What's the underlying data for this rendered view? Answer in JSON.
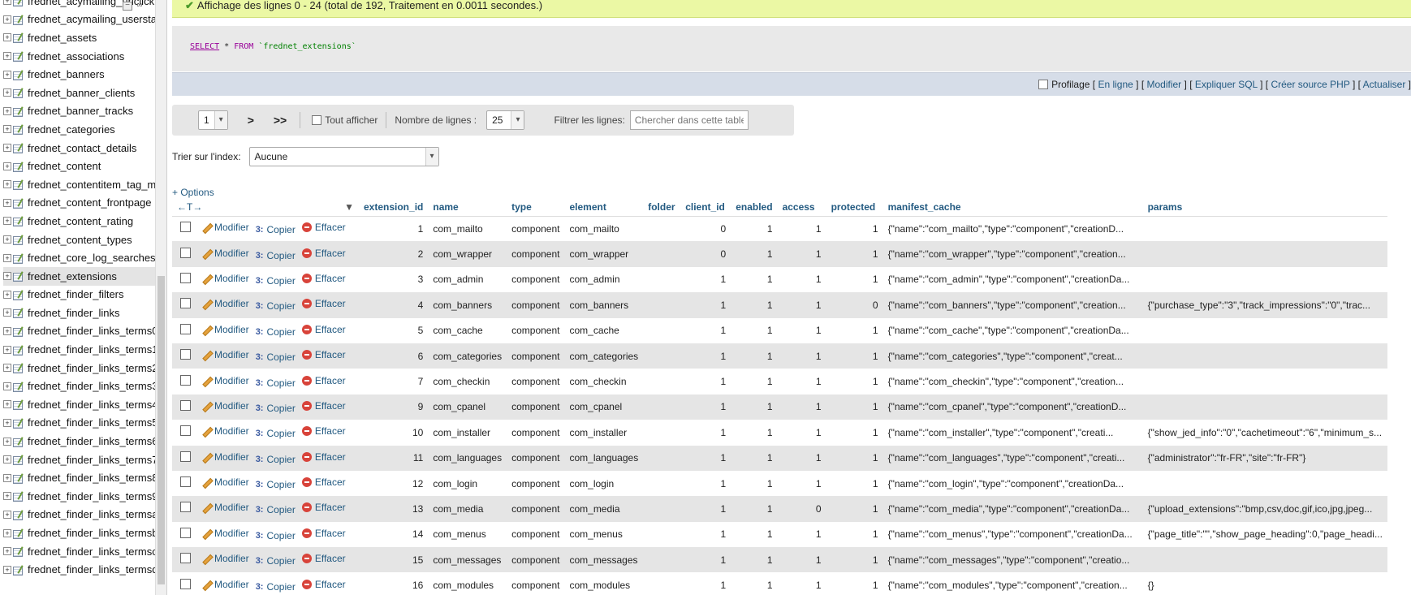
{
  "sidebar": {
    "active_table": "frednet_extensions",
    "tables": [
      "frednet_acymailing_urlclick",
      "frednet_acymailing_userstats",
      "frednet_assets",
      "frednet_associations",
      "frednet_banners",
      "frednet_banner_clients",
      "frednet_banner_tracks",
      "frednet_categories",
      "frednet_contact_details",
      "frednet_content",
      "frednet_contentitem_tag_map",
      "frednet_content_frontpage",
      "frednet_content_rating",
      "frednet_content_types",
      "frednet_core_log_searches",
      "frednet_extensions",
      "frednet_finder_filters",
      "frednet_finder_links",
      "frednet_finder_links_terms0",
      "frednet_finder_links_terms1",
      "frednet_finder_links_terms2",
      "frednet_finder_links_terms3",
      "frednet_finder_links_terms4",
      "frednet_finder_links_terms5",
      "frednet_finder_links_terms6",
      "frednet_finder_links_terms7",
      "frednet_finder_links_terms8",
      "frednet_finder_links_terms9",
      "frednet_finder_links_termsa",
      "frednet_finder_links_termsb",
      "frednet_finder_links_termsc",
      "frednet_finder_links_termsd"
    ]
  },
  "message": {
    "success": "Affichage des lignes 0 - 24 (total de 192, Traitement en 0.0011 secondes.)"
  },
  "sql": {
    "select": "SELECT",
    "star": "*",
    "from": "FROM",
    "table": "`frednet_extensions`"
  },
  "sqlbar": {
    "profiling": "Profilage",
    "inline": "En ligne",
    "edit": "Modifier",
    "explain": "Expliquer SQL",
    "php": "Créer source PHP",
    "refresh": "Actualiser"
  },
  "nav": {
    "page": "1",
    "next": ">",
    "last": ">>",
    "show_all": "Tout afficher",
    "rows_label": "Nombre de lignes :",
    "rows_value": "25",
    "filter_label": "Filtrer les lignes:",
    "filter_placeholder": "Chercher dans cette table"
  },
  "sort": {
    "label": "Trier sur l'index:",
    "value": "Aucune"
  },
  "options_link": "+ Options",
  "actions": {
    "edit": "Modifier",
    "copy": "Copier",
    "delete": "Effacer"
  },
  "table": {
    "sort_arrows": "←T→",
    "columns": [
      "extension_id",
      "name",
      "type",
      "element",
      "folder",
      "client_id",
      "enabled",
      "access",
      "protected",
      "manifest_cache",
      "params"
    ],
    "rows": [
      {
        "extension_id": "1",
        "name": "com_mailto",
        "type": "component",
        "element": "com_mailto",
        "folder": "",
        "client_id": "0",
        "enabled": "1",
        "access": "1",
        "protected": "1",
        "manifest_cache": "{\"name\":\"com_mailto\",\"type\":\"component\",\"creationD...",
        "params": ""
      },
      {
        "extension_id": "2",
        "name": "com_wrapper",
        "type": "component",
        "element": "com_wrapper",
        "folder": "",
        "client_id": "0",
        "enabled": "1",
        "access": "1",
        "protected": "1",
        "manifest_cache": "{\"name\":\"com_wrapper\",\"type\":\"component\",\"creation...",
        "params": ""
      },
      {
        "extension_id": "3",
        "name": "com_admin",
        "type": "component",
        "element": "com_admin",
        "folder": "",
        "client_id": "1",
        "enabled": "1",
        "access": "1",
        "protected": "1",
        "manifest_cache": "{\"name\":\"com_admin\",\"type\":\"component\",\"creationDa...",
        "params": ""
      },
      {
        "extension_id": "4",
        "name": "com_banners",
        "type": "component",
        "element": "com_banners",
        "folder": "",
        "client_id": "1",
        "enabled": "1",
        "access": "1",
        "protected": "0",
        "manifest_cache": "{\"name\":\"com_banners\",\"type\":\"component\",\"creation...",
        "params": "{\"purchase_type\":\"3\",\"track_impressions\":\"0\",\"trac..."
      },
      {
        "extension_id": "5",
        "name": "com_cache",
        "type": "component",
        "element": "com_cache",
        "folder": "",
        "client_id": "1",
        "enabled": "1",
        "access": "1",
        "protected": "1",
        "manifest_cache": "{\"name\":\"com_cache\",\"type\":\"component\",\"creationDa...",
        "params": ""
      },
      {
        "extension_id": "6",
        "name": "com_categories",
        "type": "component",
        "element": "com_categories",
        "folder": "",
        "client_id": "1",
        "enabled": "1",
        "access": "1",
        "protected": "1",
        "manifest_cache": "{\"name\":\"com_categories\",\"type\":\"component\",\"creat...",
        "params": ""
      },
      {
        "extension_id": "7",
        "name": "com_checkin",
        "type": "component",
        "element": "com_checkin",
        "folder": "",
        "client_id": "1",
        "enabled": "1",
        "access": "1",
        "protected": "1",
        "manifest_cache": "{\"name\":\"com_checkin\",\"type\":\"component\",\"creation...",
        "params": ""
      },
      {
        "extension_id": "9",
        "name": "com_cpanel",
        "type": "component",
        "element": "com_cpanel",
        "folder": "",
        "client_id": "1",
        "enabled": "1",
        "access": "1",
        "protected": "1",
        "manifest_cache": "{\"name\":\"com_cpanel\",\"type\":\"component\",\"creationD...",
        "params": ""
      },
      {
        "extension_id": "10",
        "name": "com_installer",
        "type": "component",
        "element": "com_installer",
        "folder": "",
        "client_id": "1",
        "enabled": "1",
        "access": "1",
        "protected": "1",
        "manifest_cache": "{\"name\":\"com_installer\",\"type\":\"component\",\"creati...",
        "params": "{\"show_jed_info\":\"0\",\"cachetimeout\":\"6\",\"minimum_s..."
      },
      {
        "extension_id": "11",
        "name": "com_languages",
        "type": "component",
        "element": "com_languages",
        "folder": "",
        "client_id": "1",
        "enabled": "1",
        "access": "1",
        "protected": "1",
        "manifest_cache": "{\"name\":\"com_languages\",\"type\":\"component\",\"creati...",
        "params": "{\"administrator\":\"fr-FR\",\"site\":\"fr-FR\"}"
      },
      {
        "extension_id": "12",
        "name": "com_login",
        "type": "component",
        "element": "com_login",
        "folder": "",
        "client_id": "1",
        "enabled": "1",
        "access": "1",
        "protected": "1",
        "manifest_cache": "{\"name\":\"com_login\",\"type\":\"component\",\"creationDa...",
        "params": ""
      },
      {
        "extension_id": "13",
        "name": "com_media",
        "type": "component",
        "element": "com_media",
        "folder": "",
        "client_id": "1",
        "enabled": "1",
        "access": "0",
        "protected": "1",
        "manifest_cache": "{\"name\":\"com_media\",\"type\":\"component\",\"creationDa...",
        "params": "{\"upload_extensions\":\"bmp,csv,doc,gif,ico,jpg,jpeg..."
      },
      {
        "extension_id": "14",
        "name": "com_menus",
        "type": "component",
        "element": "com_menus",
        "folder": "",
        "client_id": "1",
        "enabled": "1",
        "access": "1",
        "protected": "1",
        "manifest_cache": "{\"name\":\"com_menus\",\"type\":\"component\",\"creationDa...",
        "params": "{\"page_title\":\"\",\"show_page_heading\":0,\"page_headi..."
      },
      {
        "extension_id": "15",
        "name": "com_messages",
        "type": "component",
        "element": "com_messages",
        "folder": "",
        "client_id": "1",
        "enabled": "1",
        "access": "1",
        "protected": "1",
        "manifest_cache": "{\"name\":\"com_messages\",\"type\":\"component\",\"creatio...",
        "params": ""
      },
      {
        "extension_id": "16",
        "name": "com_modules",
        "type": "component",
        "element": "com_modules",
        "folder": "",
        "client_id": "1",
        "enabled": "1",
        "access": "1",
        "protected": "1",
        "manifest_cache": "{\"name\":\"com_modules\",\"type\":\"component\",\"creation...",
        "params": "{}"
      }
    ]
  },
  "colors": {
    "success_bg": "#ebf8a4",
    "link": "#235a81",
    "sql_keyword": "#990099",
    "sql_table": "#008000",
    "row_alt": "#e5e5e5"
  }
}
